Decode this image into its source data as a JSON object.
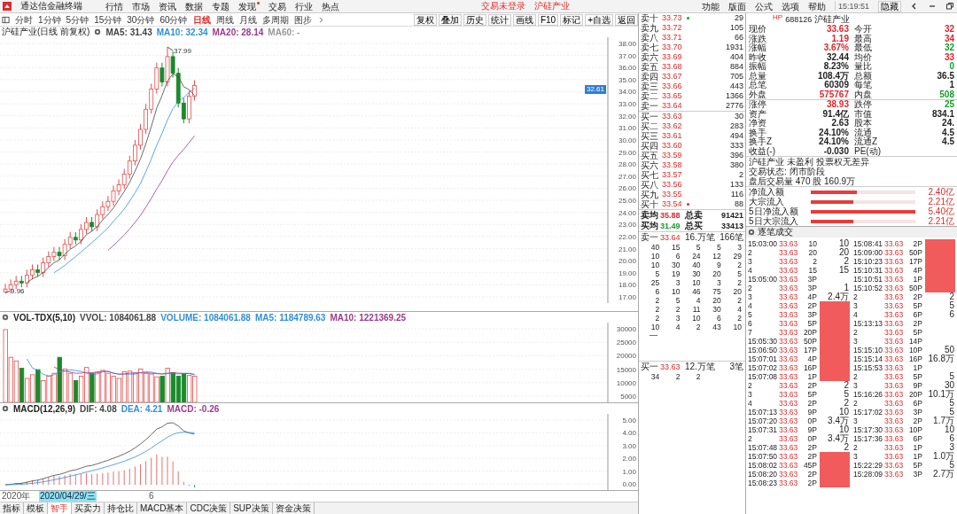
{
  "app_title": "通达信金融终端",
  "menu": [
    {
      "label": "行情",
      "badge": false
    },
    {
      "label": "市场",
      "badge": false
    },
    {
      "label": "资讯",
      "badge": false
    },
    {
      "label": "数据",
      "badge": false
    },
    {
      "label": "专题",
      "badge": false
    },
    {
      "label": "发现",
      "badge": true
    },
    {
      "label": "交易",
      "badge": false
    },
    {
      "label": "行业",
      "badge": false
    },
    {
      "label": "热点",
      "badge": false
    }
  ],
  "login_status": "交易未登录",
  "stock_title": "沪硅产业",
  "top_right_menu": [
    "功能",
    "版面",
    "公式",
    "选项",
    "帮助"
  ],
  "clock": "15:19:51",
  "hide_button": "隐藏",
  "period_tabs": [
    {
      "label": "分时",
      "selected": false
    },
    {
      "label": "1分钟",
      "selected": false
    },
    {
      "label": "5分钟",
      "selected": false
    },
    {
      "label": "15分钟",
      "selected": false
    },
    {
      "label": "30分钟",
      "selected": false
    },
    {
      "label": "60分钟",
      "selected": false
    },
    {
      "label": "日线",
      "selected": true
    },
    {
      "label": "周线",
      "selected": false
    },
    {
      "label": "月线",
      "selected": false
    },
    {
      "label": "多周期",
      "selected": false
    },
    {
      "label": "图步",
      "selected": false
    }
  ],
  "chart_tools": [
    "复权",
    "叠加",
    "历史",
    "统计",
    "画线",
    "F10",
    "标记",
    "+自选",
    "返回"
  ],
  "price_chart": {
    "title": "沪硅产业(日线 前复权)",
    "ma": [
      {
        "label": "MA5: 31.43",
        "color": "#444444"
      },
      {
        "label": "MA10: 32.34",
        "color": "#2f8fdd"
      },
      {
        "label": "MA20: 28.14",
        "color": "#9c3a8c"
      },
      {
        "label": "MA60: -",
        "color": "#999999"
      }
    ],
    "high_label": "37.99",
    "low_label": "9.96",
    "current_price": "32.61",
    "axis_labels": [
      "38.00",
      "37.00",
      "36.00",
      "35.00",
      "34.00",
      "33.00",
      "32.00",
      "31.00",
      "30.00",
      "29.00",
      "28.00",
      "27.00",
      "26.00",
      "25.00",
      "24.00",
      "23.00",
      "22.00",
      "21.00",
      "20.00",
      "19.00",
      "18.00",
      "17.00"
    ]
  },
  "volume_chart": {
    "title": "VOL-TDX(5,10)",
    "indicators": [
      {
        "label": "VVOL: 1084061.88",
        "color": "#444444"
      },
      {
        "label": "VOLUME: 1084061.88",
        "color": "#2f8fdd"
      },
      {
        "label": "MA5: 1184789.63",
        "color": "#2f8fdd"
      },
      {
        "label": "MA10: 1221369.25",
        "color": "#9c3a8c"
      }
    ],
    "axis_labels": [
      "30000",
      "25000",
      "20000",
      "15000",
      "10000",
      "5000"
    ]
  },
  "macd_chart": {
    "title": "MACD(12,26,9)",
    "indicators": [
      {
        "label": "DIF: 4.08",
        "color": "#444444"
      },
      {
        "label": "DEA: 4.21",
        "color": "#2f8fdd"
      },
      {
        "label": "MACD: -0.26",
        "color": "#9c3a8c"
      }
    ],
    "axis_labels": [
      "5.00",
      "4.00",
      "3.00",
      "2.00",
      "1.00",
      "0.00"
    ]
  },
  "date_axis": {
    "start": "2020年",
    "cursor_date": "2020/04/29/三",
    "tick": "6"
  },
  "bottom_tabs": [
    {
      "label": "指标",
      "selected": false
    },
    {
      "label": "模板",
      "selected": false
    },
    {
      "label": "智手",
      "selected": true
    },
    {
      "label": "买卖力",
      "selected": false
    },
    {
      "label": "持仓比",
      "selected": false
    },
    {
      "label": "MACD基本",
      "selected": false
    },
    {
      "label": "CDC决策",
      "selected": false
    },
    {
      "label": "SUP决策",
      "selected": false
    },
    {
      "label": "资金决策",
      "selected": false
    }
  ],
  "order_book": {
    "asks": [
      {
        "label": "卖十",
        "price": "33.73",
        "volume": "29",
        "marked": true
      },
      {
        "label": "卖九",
        "price": "33.72",
        "volume": "105",
        "marked": false
      },
      {
        "label": "卖八",
        "price": "33.71",
        "volume": "66",
        "marked": false
      },
      {
        "label": "卖七",
        "price": "33.70",
        "volume": "1931",
        "marked": false
      },
      {
        "label": "卖六",
        "price": "33.69",
        "volume": "404",
        "marked": false
      },
      {
        "label": "卖五",
        "price": "33.68",
        "volume": "884",
        "marked": false
      },
      {
        "label": "卖四",
        "price": "33.67",
        "volume": "705",
        "marked": false
      },
      {
        "label": "卖三",
        "price": "33.66",
        "volume": "443",
        "marked": false
      },
      {
        "label": "卖二",
        "price": "33.65",
        "volume": "1366",
        "marked": false
      },
      {
        "label": "卖一",
        "price": "33.64",
        "volume": "2776",
        "marked": false
      }
    ],
    "bids": [
      {
        "label": "买一",
        "price": "33.63",
        "volume": "30",
        "marked": false
      },
      {
        "label": "买二",
        "price": "33.62",
        "volume": "283",
        "marked": false
      },
      {
        "label": "买三",
        "price": "33.61",
        "volume": "494",
        "marked": false
      },
      {
        "label": "买四",
        "price": "33.60",
        "volume": "333",
        "marked": false
      },
      {
        "label": "买五",
        "price": "33.59",
        "volume": "396",
        "marked": false
      },
      {
        "label": "买六",
        "price": "33.58",
        "volume": "380",
        "marked": false
      },
      {
        "label": "买七",
        "price": "33.57",
        "volume": "2",
        "marked": false
      },
      {
        "label": "买八",
        "price": "33.56",
        "volume": "133",
        "marked": false
      },
      {
        "label": "买九",
        "price": "33.55",
        "volume": "116",
        "marked": false
      },
      {
        "label": "买十",
        "price": "33.54",
        "volume": "88",
        "marked": true
      }
    ],
    "summary": [
      {
        "label": "卖均",
        "price": "35.88",
        "color": "#e0262b",
        "label2": "总卖",
        "value": "91421"
      },
      {
        "label": "买均",
        "price": "31.49",
        "color": "#1a9c2a",
        "label2": "总买",
        "value": "33413"
      }
    ],
    "ask_queue": {
      "label": "卖一",
      "price": "33.64",
      "amount": "16.万笔",
      "count": "166笔",
      "orders": [
        [
          "40",
          "15",
          "5",
          "5",
          "3"
        ],
        [
          "10",
          "6",
          "24",
          "12",
          "29"
        ],
        [
          "10",
          "30",
          "40",
          "9",
          "2"
        ],
        [
          "5",
          "19",
          "30",
          "20",
          "5"
        ],
        [
          "25",
          "3",
          "10",
          "3",
          "2"
        ],
        [
          "6",
          "10",
          "46",
          "75",
          "20"
        ],
        [
          "2",
          "5",
          "4",
          "20",
          "2"
        ],
        [
          "2",
          "2",
          "11",
          "30",
          "4"
        ],
        [
          "2",
          "3",
          "10",
          "6",
          "2"
        ],
        [
          "10",
          "4",
          "2",
          "43",
          "10"
        ]
      ],
      "end_mark": "—"
    },
    "bid_queue": {
      "label": "买一",
      "price": "33.63",
      "amount": "12.万笔",
      "count": "3笔",
      "orders": [
        [
          "34",
          "2",
          "2"
        ]
      ]
    }
  },
  "quote": {
    "market_tag": "HP",
    "code": "688126",
    "name": "沪硅产业",
    "fields": [
      {
        "label": "现价",
        "value": "33.63",
        "color": "#e0262b"
      },
      {
        "label": "今开",
        "value": "32",
        "color": "#e0262b"
      },
      {
        "label": "涨跌",
        "value": "1.19",
        "color": "#e0262b"
      },
      {
        "label": "最高",
        "value": "34",
        "color": "#e0262b"
      },
      {
        "label": "涨幅",
        "value": "3.67%",
        "color": "#e0262b"
      },
      {
        "label": "最低",
        "value": "32",
        "color": "#1a9c2a"
      },
      {
        "label": "昨收",
        "value": "32.44",
        "color": "#222222"
      },
      {
        "label": "均价",
        "value": "33",
        "color": "#e0262b"
      },
      {
        "label": "振幅",
        "value": "8.23%",
        "color": "#222222"
      },
      {
        "label": "量比",
        "value": "0",
        "color": "#1a9c2a"
      },
      {
        "label": "总量",
        "value": "108.4万",
        "color": "#222222"
      },
      {
        "label": "总额",
        "value": "36.5",
        "color": "#222222"
      },
      {
        "label": "总笔",
        "value": "60309",
        "color": "#222222"
      },
      {
        "label": "每笔",
        "value": "1",
        "color": "#222222"
      },
      {
        "label": "外盘",
        "value": "575767",
        "color": "#e0262b"
      },
      {
        "label": "内盘",
        "value": "508",
        "color": "#1a9c2a"
      }
    ],
    "fields_b": [
      {
        "label": "涨停",
        "value": "38.93",
        "color": "#e0262b"
      },
      {
        "label": "跌停",
        "value": "25",
        "color": "#1a9c2a"
      },
      {
        "label": "资产",
        "value": "91.4亿",
        "color": "#222222"
      },
      {
        "label": "市值",
        "value": "834.1",
        "color": "#222222"
      },
      {
        "label": "净资",
        "value": "2.63",
        "color": "#222222"
      },
      {
        "label": "股本",
        "value": "24.",
        "color": "#222222"
      },
      {
        "label": "换手",
        "value": "24.10%",
        "color": "#222222"
      },
      {
        "label": "流通",
        "value": "4.5",
        "color": "#222222"
      },
      {
        "label": "换手Z",
        "value": "24.10%",
        "color": "#222222"
      },
      {
        "label": "流通Z",
        "value": "4.5",
        "color": "#222222"
      },
      {
        "label": "收益(-)",
        "value": "-0.030",
        "color": "#222222"
      },
      {
        "label": "PE(动)"
      }
    ],
    "notes": [
      "沪硅产业 未盈利 投票权无差异",
      "交易状态: 闭市阶段",
      "盘后交易量 470 股 160.9万"
    ],
    "flows": [
      {
        "label": "净流入额",
        "level": 0.44,
        "value": "2.40亿"
      },
      {
        "label": "大宗流入",
        "level": 0.41,
        "value": "2.21亿"
      },
      {
        "label": "5日净流入额",
        "level": 1.0,
        "value": "5.40亿"
      },
      {
        "label": "5日大宗流入",
        "level": 0.41,
        "value": "2.21亿"
      }
    ]
  },
  "trades": {
    "title": "逐笔成交",
    "rows": [
      {
        "time": "15:03:00",
        "price": "33.63",
        "volume": "10",
        "note": "10",
        "big": false
      },
      {
        "time": "2",
        "price": "33.63",
        "volume": "20",
        "note": "20",
        "big": false
      },
      {
        "time": "3",
        "price": "33.63",
        "volume": "2",
        "note": "2",
        "big": false
      },
      {
        "time": "4",
        "price": "33.63",
        "volume": "15",
        "note": "15",
        "big": false
      },
      {
        "time": "15:05:00",
        "price": "33.63",
        "volume": "3P",
        "big": false
      },
      {
        "time": "2",
        "price": "33.63",
        "volume": "3P",
        "note": "1",
        "big": false
      },
      {
        "time": "3",
        "price": "33.63",
        "volume": "4P",
        "note": "2.4万",
        "big": false
      },
      {
        "time": "4",
        "price": "33.63",
        "volume": "2P",
        "big": true
      },
      {
        "time": "5",
        "price": "33.63",
        "volume": "3P",
        "big": true
      },
      {
        "time": "6",
        "price": "33.63",
        "volume": "5P",
        "big": true
      },
      {
        "time": "7",
        "price": "33.63",
        "volume": "20P",
        "big": true
      },
      {
        "time": "15:05:30",
        "price": "33.63",
        "volume": "50P",
        "big": true
      },
      {
        "time": "15:06:50",
        "price": "33.63",
        "volume": "17P",
        "big": true
      },
      {
        "time": "15:07:01",
        "price": "33.63",
        "volume": "4P",
        "big": true
      },
      {
        "time": "15:07:02",
        "price": "33.63",
        "volume": "16P",
        "big": true
      },
      {
        "time": "15:07:08",
        "price": "33.63",
        "volume": "1P",
        "big": true
      },
      {
        "time": "2",
        "price": "33.63",
        "volume": "2P",
        "note": "2",
        "big": false
      },
      {
        "time": "3",
        "price": "33.63",
        "volume": "5P",
        "note": "5",
        "big": false
      },
      {
        "time": "4",
        "price": "33.63",
        "volume": "2P",
        "note": "2",
        "big": false
      },
      {
        "time": "15:07:13",
        "price": "33.63",
        "volume": "9P",
        "note": "10",
        "big": false
      },
      {
        "time": "15:07:20",
        "price": "33.63",
        "volume": "0P",
        "note": "3.4万",
        "big": false
      },
      {
        "time": "15:07:31",
        "price": "33.63",
        "volume": "9P",
        "note": "10",
        "big": false
      },
      {
        "time": "2",
        "price": "33.63",
        "volume": "0P",
        "note": "3.4万",
        "big": false
      },
      {
        "time": "15:07:48",
        "price": "33.63",
        "volume": "2P",
        "note": "2",
        "big": false
      },
      {
        "time": "15:07:50",
        "price": "33.63",
        "volume": "2P",
        "big": true
      },
      {
        "time": "15:08:02",
        "price": "33.63",
        "volume": "45P",
        "big": true
      },
      {
        "time": "15:08:20",
        "price": "33.63",
        "volume": "2P",
        "big": true
      },
      {
        "time": "15:08:23",
        "price": "33.63",
        "volume": "2P",
        "big": true
      },
      {
        "time": "15:08:41",
        "price": "33.63",
        "volume": "2P",
        "big": true
      },
      {
        "time": "15:09:00",
        "price": "33.63",
        "volume": "50P",
        "big": true
      },
      {
        "time": "15:10:23",
        "price": "33.63",
        "volume": "17P",
        "big": true
      },
      {
        "time": "15:10:31",
        "price": "33.63",
        "volume": "4P",
        "big": true
      },
      {
        "time": "15:10:51",
        "price": "33.63",
        "volume": "1P",
        "big": true
      },
      {
        "time": "15:10:52",
        "price": "33.63",
        "volume": "50P",
        "big": true
      },
      {
        "time": "2",
        "price": "33.63",
        "volume": "2P",
        "note": "2",
        "big": false
      },
      {
        "time": "3",
        "price": "33.63",
        "volume": "5P",
        "note": "5",
        "big": false
      },
      {
        "time": "4",
        "price": "33.63",
        "volume": "6P",
        "note": "6",
        "big": false
      },
      {
        "time": "15:13:13",
        "price": "33.63",
        "volume": "2P",
        "big": false
      },
      {
        "time": "2",
        "price": "33.63",
        "volume": "5P",
        "big": false
      },
      {
        "time": "3",
        "price": "33.63",
        "volume": "14P",
        "big": false
      },
      {
        "time": "15:15:10",
        "price": "33.63",
        "volume": "10P",
        "note": "50",
        "big": false
      },
      {
        "time": "15:15:14",
        "price": "33.63",
        "volume": "16P",
        "note": "16.8万",
        "big": false
      },
      {
        "time": "15:15:53",
        "price": "33.63",
        "volume": "1P",
        "big": false
      },
      {
        "time": "2",
        "price": "33.63",
        "volume": "5P",
        "note": "5",
        "big": false
      },
      {
        "time": "3",
        "price": "33.63",
        "volume": "9P",
        "note": "30",
        "big": false
      },
      {
        "time": "15:16:26",
        "price": "33.63",
        "volume": "20P",
        "note": "10.1万",
        "big": false
      },
      {
        "time": "2",
        "price": "33.63",
        "volume": "6P",
        "note": "5",
        "big": false
      },
      {
        "time": "15:17:02",
        "price": "33.63",
        "volume": "3P",
        "note": "5",
        "big": false
      },
      {
        "time": "3",
        "price": "33.63",
        "volume": "2P",
        "note": "1.7万",
        "big": false
      },
      {
        "time": "15:17:30",
        "price": "33.63",
        "volume": "10P",
        "note": "10",
        "big": false
      },
      {
        "time": "15:17:36",
        "price": "33.63",
        "volume": "6P",
        "note": "6",
        "big": false
      },
      {
        "time": "2",
        "price": "33.63",
        "volume": "1P",
        "note": "3",
        "big": false
      },
      {
        "time": "3",
        "price": "33.63",
        "volume": "1P",
        "note": "1.0万",
        "big": false
      },
      {
        "time": "15:22:29",
        "price": "33.63",
        "volume": "5P",
        "note": "5",
        "big": false
      },
      {
        "time": "15:28:09",
        "price": "33.63",
        "volume": "3P",
        "note": "2.7万",
        "big": false
      }
    ]
  }
}
